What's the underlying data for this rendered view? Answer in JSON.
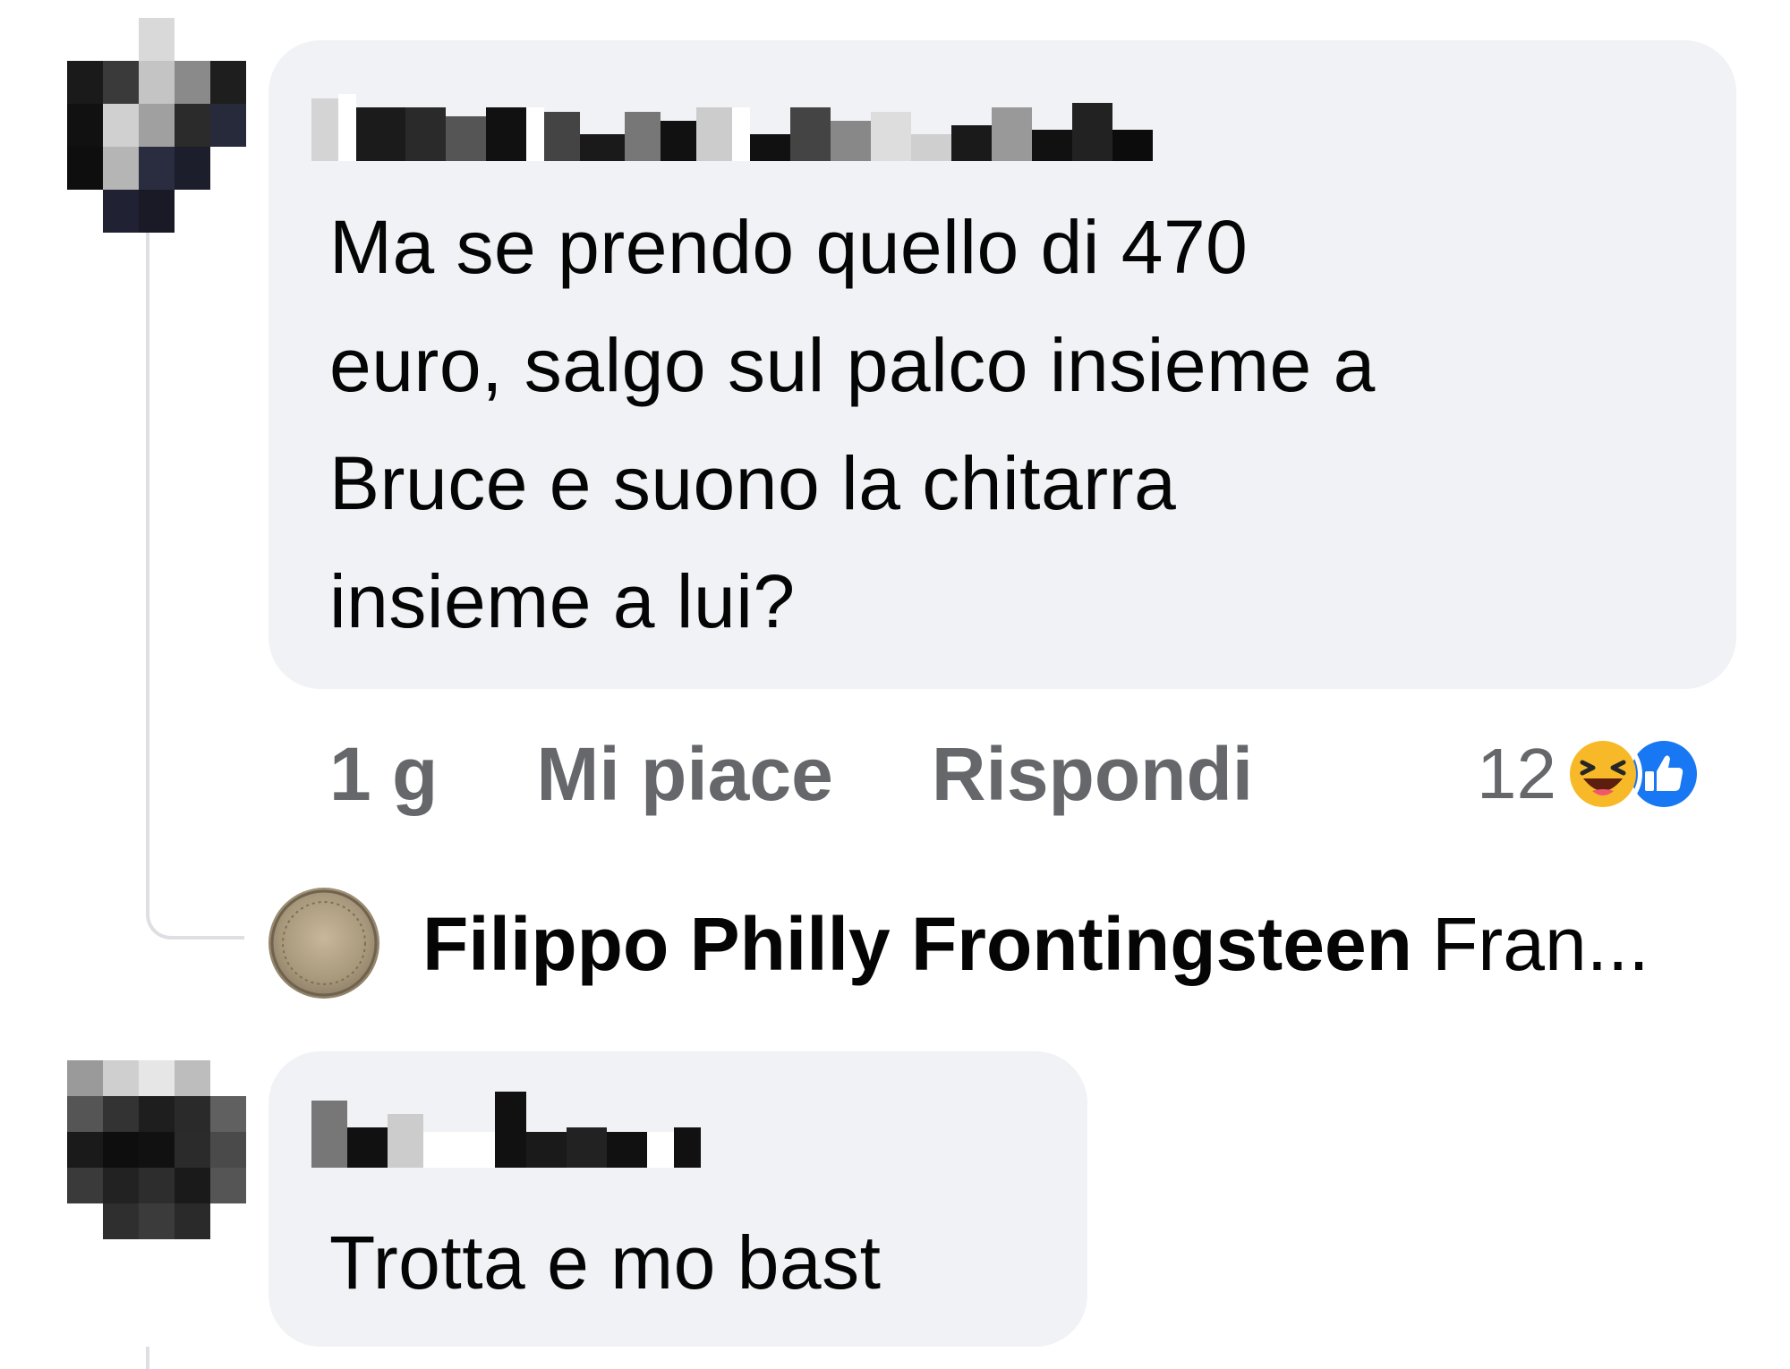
{
  "comments": [
    {
      "author": "",
      "text": "Ma se prendo quello di 470\neuro, salgo sul palco insieme a\nBruce e suono la chitarra\ninsieme a lui?",
      "time": "1 g",
      "like_label": "Mi piace",
      "reply_label": "Rispondi",
      "reaction_count": "12",
      "reactions": [
        "haha-icon",
        "like-icon"
      ],
      "reply_preview": {
        "author": "Filippo Philly Frontingsteen",
        "snippet": "Fran..."
      }
    },
    {
      "author": "",
      "text": "Trotta e mo bast"
    }
  ],
  "colors": {
    "bubble": "#f0f2f5",
    "text": "#050505",
    "secondary_text": "#65676b",
    "like_blue": "#1877f2",
    "haha_yellow": "#f7b928",
    "thread_line": "#dddfe3"
  }
}
